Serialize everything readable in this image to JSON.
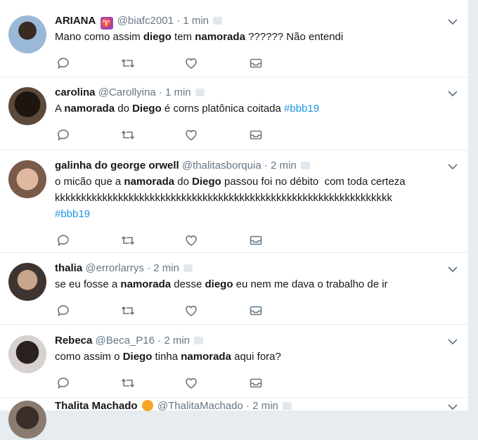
{
  "tweets": [
    {
      "name": "ARIANA",
      "name_emoji": "♈",
      "handle": "@biafc2001",
      "separator": "·",
      "time": "1 min",
      "parts": [
        {
          "t": "Mano como assim "
        },
        {
          "b": "diego"
        },
        {
          "t": " tem "
        },
        {
          "b": "namorada"
        },
        {
          "t": " ?????? Não entendi"
        }
      ]
    },
    {
      "name": "carolina",
      "handle": "@Carollyina",
      "separator": "·",
      "time": "1 min",
      "parts": [
        {
          "t": "A "
        },
        {
          "b": "namorada"
        },
        {
          "t": " do "
        },
        {
          "b": "Diego"
        },
        {
          "t": " é corns platônica coitada "
        },
        {
          "h": "#bbb19"
        }
      ]
    },
    {
      "name": "galinha do george orwell",
      "handle": "@thalitasborquia",
      "separator": "·",
      "time": "2 min",
      "parts": [
        {
          "t": "o micão que a "
        },
        {
          "b": "namorada"
        },
        {
          "t": " do "
        },
        {
          "b": "Diego"
        },
        {
          "t": " passou foi no débito  com toda certeza\nkkkkkkkkkkkkkkkkkkkkkkkkkkkkkkkkkkkkkkkkkkkkkkkkkkkkkkkkkkkkkkkk\n"
        },
        {
          "h": "#bbb19"
        }
      ]
    },
    {
      "name": "thalia",
      "handle": "@errorlarrys",
      "separator": "·",
      "time": "2 min",
      "parts": [
        {
          "t": "se eu fosse a "
        },
        {
          "b": "namorada"
        },
        {
          "t": " desse "
        },
        {
          "b": "diego"
        },
        {
          "t": " eu nem me dava o trabalho de ir"
        }
      ]
    },
    {
      "name": "Rebeca",
      "handle": "@Beca_P16",
      "separator": "·",
      "time": "2 min",
      "parts": [
        {
          "t": "como assim o "
        },
        {
          "b": "Diego"
        },
        {
          "t": " tinha "
        },
        {
          "b": "namorada"
        },
        {
          "t": " aqui fora?"
        }
      ]
    },
    {
      "name": "Thalita Machado",
      "name_emoji": "🌻",
      "handle": "@ThalitaMachado",
      "separator": "·",
      "time": "2 min",
      "parts": []
    }
  ],
  "icons": {
    "reply": "reply-icon",
    "retweet": "retweet-icon",
    "like": "heart-icon",
    "dm": "envelope-icon",
    "menu": "chevron-down-icon"
  },
  "colors": {
    "muted": "#657786",
    "hashtag": "#1b95e0",
    "divider": "#e6ecf0"
  }
}
